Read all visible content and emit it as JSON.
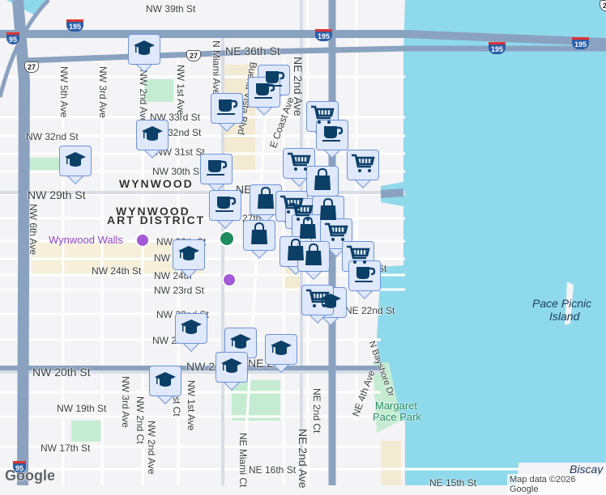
{
  "streets": {
    "nw39": "NW 39th St",
    "ne36": "NE 36th St",
    "nw33": "NW 33rd St",
    "nw32a": "NW 32nd St",
    "nw32b": "32nd St",
    "nw31": "NW 31st St",
    "nw30": "NW 30th St",
    "nw29": "NW 29th St",
    "ne29": "NE",
    "nw27": "27th",
    "nw26": "NW 26th St",
    "nw25": "NW 2",
    "nw24a": "NW 24th St",
    "nw24b": "NW 24th",
    "nw23": "NW 23rd St",
    "nw22": "NW 22nd St",
    "ne22": "NE 22nd St",
    "nw21": "NW 2",
    "nw20": "NW 20th St",
    "nw20b": "NW 20th St",
    "ne20": "NE 20",
    "nw19": "NW 19th St",
    "nw17": "NW 17th St",
    "ne16": "NE 16th St",
    "ne15": "NE 15th St",
    "ne23": "St",
    "nw5": "NW 5th Ave",
    "nw3": "NW 3rd Ave",
    "nw2": "NW 2nd Ave",
    "nw1": "NW 1st Ave",
    "nmiami": "N Miami Ave",
    "buena": "Buena Vista Blvd",
    "ecoast": "E Coast Ave",
    "ne2": "NE 2nd Ave",
    "ne2b": "NE 2nd Ave",
    "nw6": "NW 6th Ave",
    "nw3b": "NW 3rd Ave",
    "nw2ct": "NW 2nd Ct",
    "nw2b": "NW 2nd Ave",
    "nw1ct": "st Ct",
    "nw1b": "NW 1st Ave",
    "nemiamict": "NE Miami Ct",
    "ne2ct": "NE 2nd Ct",
    "ne4": "NE 4th Ave",
    "bayshore": "N Bayshore Dr"
  },
  "areas": {
    "wynwood": "WYNWOOD",
    "artdistrict1": "WYNWOOD",
    "artdistrict2": "ART DISTRICT",
    "pace1": "Pace Picnic",
    "pace2": "Island",
    "margaret1": "Margaret",
    "margaret2": "Pace Park",
    "biscayne": "Biscay"
  },
  "pois": {
    "wynwood_walls": "Wynwood Walls"
  },
  "shields": {
    "i195a": "195",
    "i195b": "195",
    "i195c": "195",
    "i195d": "195",
    "i95a": "95",
    "i95b": "95",
    "us27a": "27",
    "us27b": "27",
    "us27c": "27"
  },
  "footer": {
    "logo": "Google",
    "attribution": "Map data ©2026 Google"
  },
  "colors": {
    "water": "#8fd9ec",
    "highway": "#8aa2c0",
    "park": "#c5ecd2",
    "marker_fill": "#dfe9fb",
    "marker_icon": "#0b3f66"
  },
  "markers": [
    {
      "type": "school"
    },
    {
      "type": "coffee"
    },
    {
      "type": "coffee"
    },
    {
      "type": "coffee"
    },
    {
      "type": "school"
    },
    {
      "type": "school"
    },
    {
      "type": "cart"
    },
    {
      "type": "coffee"
    },
    {
      "type": "cart"
    },
    {
      "type": "bag"
    },
    {
      "type": "cart"
    },
    {
      "type": "coffee"
    },
    {
      "type": "coffee"
    },
    {
      "type": "bag"
    },
    {
      "type": "cart"
    },
    {
      "type": "cart"
    },
    {
      "type": "bag"
    },
    {
      "type": "bag"
    },
    {
      "type": "bag"
    },
    {
      "type": "cart"
    },
    {
      "type": "bag"
    },
    {
      "type": "bag"
    },
    {
      "type": "cart"
    },
    {
      "type": "coffee"
    },
    {
      "type": "school"
    },
    {
      "type": "cart"
    },
    {
      "type": "school"
    },
    {
      "type": "school"
    },
    {
      "type": "school"
    },
    {
      "type": "school"
    },
    {
      "type": "school"
    },
    {
      "type": "school"
    }
  ]
}
